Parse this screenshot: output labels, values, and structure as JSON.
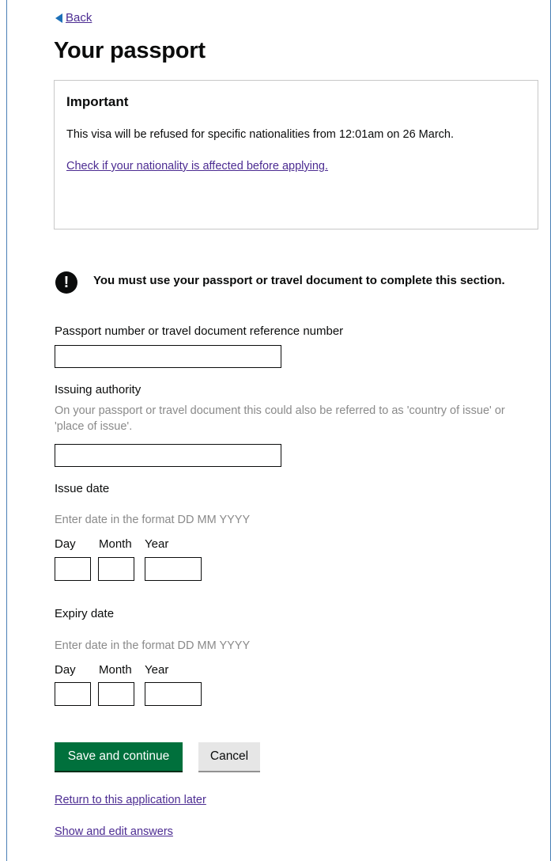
{
  "nav": {
    "back_label": "Back"
  },
  "page": {
    "title": "Your passport"
  },
  "important": {
    "heading": "Important",
    "text": "This visa will be refused for specific nationalities from 12:01am on 26 March.",
    "link": "Check if your nationality is affected before applying."
  },
  "warning": {
    "icon": "!",
    "text": "You must use your passport or travel document to complete this section."
  },
  "passport_number": {
    "label": "Passport number or travel document reference number",
    "value": ""
  },
  "issuing_authority": {
    "label": "Issuing authority",
    "hint": "On your passport or travel document this could also be referred to as 'country of issue' or 'place of issue'.",
    "value": ""
  },
  "issue_date": {
    "label": "Issue date",
    "hint": "Enter date in the format DD MM YYYY",
    "day_label": "Day",
    "month_label": "Month",
    "year_label": "Year",
    "day": "",
    "month": "",
    "year": ""
  },
  "expiry_date": {
    "label": "Expiry date",
    "hint": "Enter date in the format DD MM YYYY",
    "day_label": "Day",
    "month_label": "Month",
    "year_label": "Year",
    "day": "",
    "month": "",
    "year": ""
  },
  "actions": {
    "save_label": "Save and continue",
    "cancel_label": "Cancel",
    "return_link": "Return to this application later",
    "show_answers_link": "Show and edit answers"
  },
  "colors": {
    "link": "#4c2c92",
    "save_button": "#00703c",
    "cancel_button": "#e6e6e6"
  }
}
